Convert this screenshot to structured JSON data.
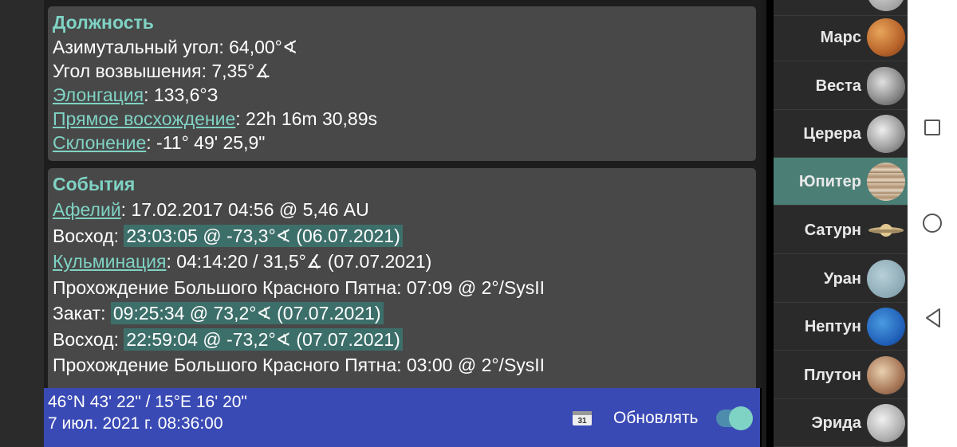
{
  "position": {
    "title": "Должность",
    "azimuth_label": "Азимутальный угол: ",
    "azimuth_value": "64,00°∢",
    "altitude_label": "Угол возвышения: ",
    "altitude_value": "7,35°∡",
    "elongation_link": "Элонгация",
    "elongation_value": ": 133,6°З",
    "ra_link": "Прямое восхождение",
    "ra_value": ": 22h 16m 30,89s",
    "dec_link": "Склонение",
    "dec_value": ": -11° 49' 25,9\""
  },
  "events": {
    "title": "События",
    "aphelion_link": "Афелий",
    "aphelion_value": ": 17.02.2017 04:56 @ 5,46 AU",
    "rise1_label": "Восход: ",
    "rise1_value": "23:03:05 @ -73,3°∢ (06.07.2021)",
    "culm_link": "Кульминация",
    "culm_value": ": 04:14:20 / 31,5°∡ (07.07.2021)",
    "grs1": "Прохождение Большого Красного Пятна: 07:09 @ 2°/SysII",
    "set_label": "Закат: ",
    "set_value": "09:25:34 @ 73,2°∢ (07.07.2021)",
    "rise2_label": "Восход: ",
    "rise2_value": "22:59:04 @ -73,2°∢ (07.07.2021)",
    "grs2": "Прохождение Большого Красного Пятна: 03:00 @ 2°/SysII"
  },
  "status": {
    "coords": "46°N 43' 22\" / 15°E 16' 20\"",
    "datetime": "7 июл. 2021 г. 08:36:00",
    "calendar_day": "31",
    "update_label": "Обновлять",
    "update_on": true
  },
  "planets": [
    {
      "name": "Марс",
      "selected": false
    },
    {
      "name": "Веста",
      "selected": false
    },
    {
      "name": "Церера",
      "selected": false
    },
    {
      "name": "Юпитер",
      "selected": true
    },
    {
      "name": "Сатурн",
      "selected": false
    },
    {
      "name": "Уран",
      "selected": false
    },
    {
      "name": "Нептун",
      "selected": false
    },
    {
      "name": "Плутон",
      "selected": false
    },
    {
      "name": "Эрида",
      "selected": false
    }
  ],
  "colors": {
    "accent": "#7fd3c4",
    "highlight": "#3d6f6a",
    "status_bar": "#3a4ab5",
    "selected_planet": "#4b7f76"
  }
}
